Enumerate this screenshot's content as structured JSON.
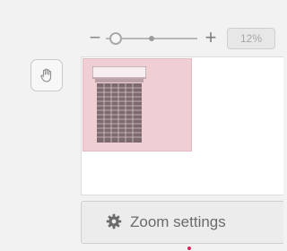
{
  "zoom_bar": {
    "minus_label": "−",
    "plus_label": "+",
    "value": "12%"
  },
  "navigator": {
    "hand_tool_icon": "hand-icon",
    "viewport_color": "#efcfd3"
  },
  "zoom_settings": {
    "icon": "gear-icon",
    "label": "Zoom settings"
  }
}
